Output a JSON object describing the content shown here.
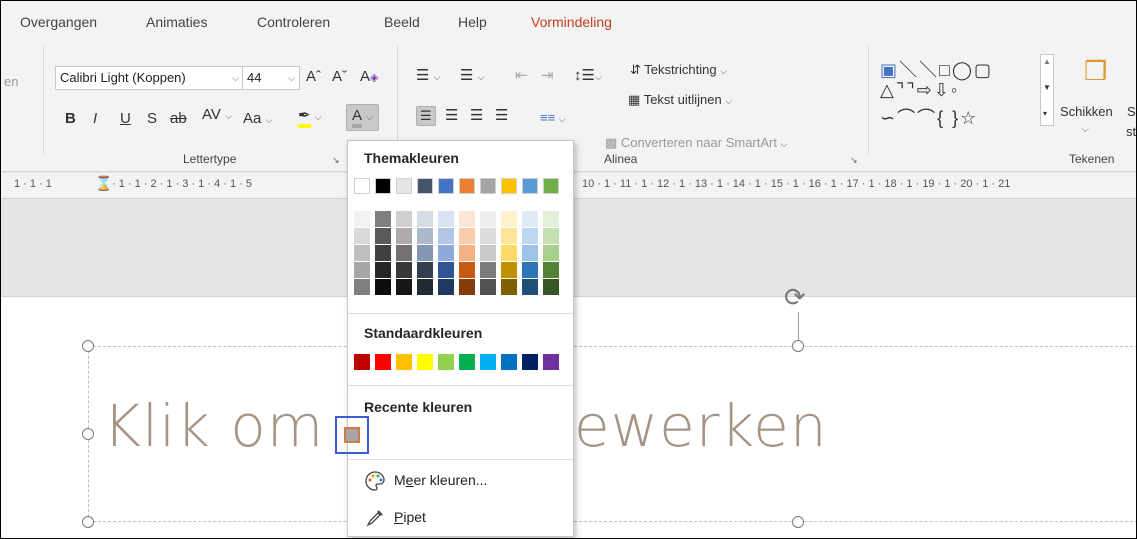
{
  "tabs": {
    "overgangen": "Overgangen",
    "animaties": "Animaties",
    "controleren": "Controleren",
    "beeld": "Beeld",
    "help": "Help",
    "vormindeling": "Vormindeling"
  },
  "ribbon": {
    "partial_left": "en",
    "font_name": "Calibri Light (Koppen)",
    "font_size": "44",
    "grow_font": "Aˆ",
    "shrink_font": "Aˇ",
    "bold": "B",
    "italic": "I",
    "underline": "U",
    "shadow": "S",
    "strikethrough": "ab",
    "char_spacing": "AV",
    "change_case": "Aa",
    "font_color": "A",
    "lettertype_label": "Lettertype",
    "text_direction": "Tekstrichting",
    "align_text": "Tekst uitlijnen",
    "convert_smartart": "Converteren naar SmartArt",
    "alinea_label": "Alinea",
    "arrange": "Schikken",
    "partial_right_top": "S",
    "partial_right_bottom": "st",
    "tekenen_label": "Tekenen"
  },
  "ruler": {
    "left": "1 · 1 · 1",
    "segment_a": "· 1 · 1 · 2 · 1 · 3 · 1 · 4 · 1 · 5",
    "segment_b": "10 · 1 · 11 · 1 · 12 · 1 · 13 · 1 · 14 · 1 · 15 · 1 · 16 · 1 · 17 · 1 · 18 · 1 · 19 · 1 · 20 · 1 · 21"
  },
  "slide": {
    "title_left": "Klik om",
    "title_right": "ewerken"
  },
  "dropdown": {
    "theme_title": "Themakleuren",
    "standard_title": "Standaardkleuren",
    "recent_title": "Recente kleuren",
    "more_colors": "Meer kleuren...",
    "more_colors_accel": "e",
    "pipet": "Pipet",
    "pipet_accel": "P",
    "theme_colors": [
      "#ffffff",
      "#000000",
      "#e7e6e6",
      "#44546a",
      "#4472c4",
      "#ed7d31",
      "#a5a5a5",
      "#ffc000",
      "#5b9bd5",
      "#70ad47"
    ],
    "theme_shades": [
      [
        "#f2f2f2",
        "#d9d9d9",
        "#bfbfbf",
        "#a6a6a6",
        "#808080"
      ],
      [
        "#7f7f7f",
        "#595959",
        "#404040",
        "#262626",
        "#0d0d0d"
      ],
      [
        "#d0cece",
        "#aeaaaa",
        "#757171",
        "#3a3838",
        "#161616"
      ],
      [
        "#d6dce4",
        "#adb9ca",
        "#8497b0",
        "#333f4f",
        "#222a35"
      ],
      [
        "#d9e2f3",
        "#b4c6e7",
        "#8eaadb",
        "#2f5496",
        "#1f3864"
      ],
      [
        "#fbe5d5",
        "#f7cbac",
        "#f4b183",
        "#c55a11",
        "#843c0b"
      ],
      [
        "#ededed",
        "#dbdbdb",
        "#c9c9c9",
        "#7b7b7b",
        "#525252"
      ],
      [
        "#fff2cc",
        "#ffe599",
        "#ffd966",
        "#bf9000",
        "#7f6000"
      ],
      [
        "#deebf6",
        "#bdd7ee",
        "#9dc3e6",
        "#2e75b5",
        "#1f4e79"
      ],
      [
        "#e2efd9",
        "#c5e0b3",
        "#a8d08d",
        "#538135",
        "#375623"
      ]
    ],
    "standard_colors": [
      "#c00000",
      "#ff0000",
      "#ffc000",
      "#ffff00",
      "#92d050",
      "#00b050",
      "#00b0f0",
      "#0070c0",
      "#002060",
      "#7030a0"
    ],
    "recent_color": "#a6a6a6"
  }
}
